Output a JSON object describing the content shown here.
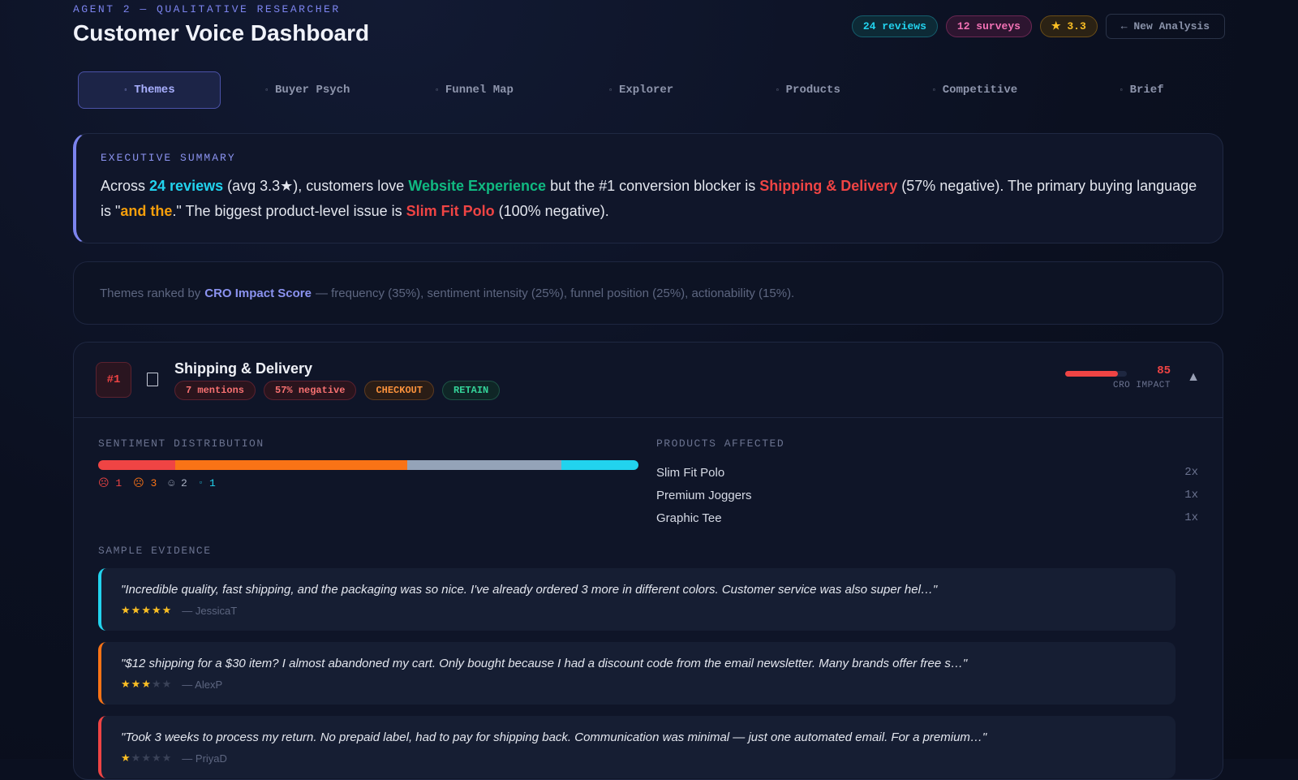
{
  "header": {
    "agent_label": "AGENT 2 — QUALITATIVE RESEARCHER",
    "title": "Customer Voice Dashboard",
    "badges": {
      "reviews": "24 reviews",
      "surveys": "12 surveys",
      "rating": "★ 3.3"
    },
    "new_analysis_label": "← New Analysis"
  },
  "tabs": [
    {
      "label": "Themes",
      "icon": "▫"
    },
    {
      "label": "Buyer Psych",
      "icon": "▫"
    },
    {
      "label": "Funnel Map",
      "icon": "▫"
    },
    {
      "label": "Explorer",
      "icon": "▫"
    },
    {
      "label": "Products",
      "icon": "▫"
    },
    {
      "label": "Competitive",
      "icon": "▫"
    },
    {
      "label": "Brief",
      "icon": "▫"
    }
  ],
  "executive_summary": {
    "label": "EXECUTIVE SUMMARY",
    "p1": "Across ",
    "reviews": "24 reviews",
    "p2": " (avg 3.3★), customers love ",
    "love_theme": "Website Experience",
    "p3": " but the #1 conversion blocker is ",
    "blocker": "Shipping & Delivery",
    "p4": " (57% negative). The primary buying language is \"",
    "language": "and the",
    "p5": ".\" The biggest product-level issue is ",
    "product_issue": "Slim Fit Polo",
    "p6": " (100% negative)."
  },
  "ranking_note": {
    "prefix": "Themes ranked by",
    "highlight": "CRO Impact Score",
    "suffix": "— frequency (35%), sentiment intensity (25%), funnel position (25%), actionability (15%)."
  },
  "theme": {
    "rank": "#1",
    "icon": "box-icon",
    "title": "Shipping & Delivery",
    "tags": {
      "mentions": "7 mentions",
      "negative": "57% negative",
      "stage1": "CHECKOUT",
      "stage2": "RETAIN"
    },
    "impact_score": "85",
    "impact_value": 85,
    "impact_label": "CRO IMPACT",
    "collapse_icon": "▲",
    "sentiment": {
      "label": "SENTIMENT DISTRIBUTION",
      "segments": [
        {
          "key": "very_negative",
          "count": 1,
          "icon": "☹",
          "color": "#ef4444",
          "display": "1"
        },
        {
          "key": "negative",
          "count": 3,
          "icon": "☹",
          "color": "#f97316",
          "display": "3"
        },
        {
          "key": "neutral",
          "count": 2,
          "icon": "☺",
          "color": "#94a3b8",
          "display": "2"
        },
        {
          "key": "positive",
          "count": 1,
          "icon": "▫",
          "color": "#22d3ee",
          "display": "1"
        }
      ]
    },
    "products": {
      "label": "PRODUCTS AFFECTED",
      "items": [
        {
          "name": "Slim Fit Polo",
          "count": "2x"
        },
        {
          "name": "Premium Joggers",
          "count": "1x"
        },
        {
          "name": "Graphic Tee",
          "count": "1x"
        }
      ]
    },
    "evidence": {
      "label": "SAMPLE EVIDENCE",
      "quotes": [
        {
          "text": "\"Incredible quality, fast shipping, and the packaging was so nice. I've already ordered 3 more in different colors. Customer service was also super hel…\"",
          "rating": 5,
          "author": "— JessicaT",
          "color": "#22d3ee"
        },
        {
          "text": "\"$12 shipping for a $30 item? I almost abandoned my cart. Only bought because I had a discount code from the email newsletter. Many brands offer free s…\"",
          "rating": 3,
          "author": "— AlexP",
          "color": "#f97316"
        },
        {
          "text": "\"Took 3 weeks to process my return. No prepaid label, had to pay for shipping back. Communication was minimal — just one automated email. For a premium…\"",
          "rating": 1,
          "author": "— PriyaD",
          "color": "#ef4444"
        }
      ]
    }
  }
}
